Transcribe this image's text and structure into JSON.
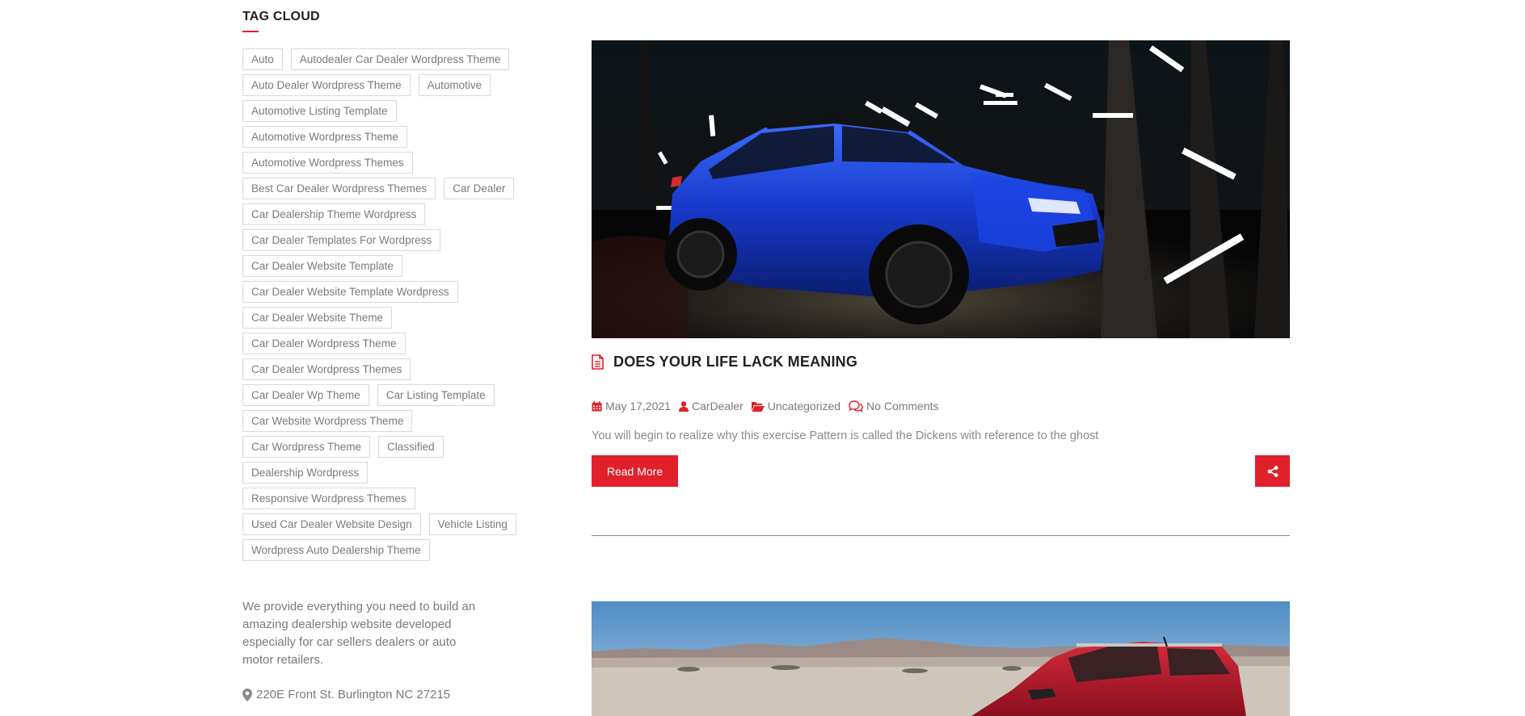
{
  "sidebar": {
    "title": "TAG CLOUD",
    "tags": [
      "Auto",
      "Autodealer Car Dealer Wordpress Theme",
      "Auto Dealer Wordpress Theme",
      "Automotive",
      "Automotive Listing Template",
      "Automotive Wordpress Theme",
      "Automotive Wordpress Themes",
      "Best Car Dealer Wordpress Themes",
      "Car Dealer",
      "Car Dealership Theme Wordpress",
      "Car Dealer Templates For Wordpress",
      "Car Dealer Website Template",
      "Car Dealer Website Template Wordpress",
      "Car Dealer Website Theme",
      "Car Dealer Wordpress Theme",
      "Car Dealer Wordpress Themes",
      "Car Dealer Wp Theme",
      "Car Listing Template",
      "Car Website Wordpress Theme",
      "Car Wordpress Theme",
      "Classified",
      "Dealership Wordpress",
      "Responsive Wordpress Themes",
      "Used Car Dealer Website Design",
      "Vehicle Listing",
      "Wordpress Auto Dealership Theme"
    ],
    "about_text": "We provide everything you need to build an amazing dealership website developed especially for car sellers dealers or auto motor retailers.",
    "address": "220E Front St. Burlington NC 27215"
  },
  "post": {
    "title": "DOES YOUR LIFE LACK MEANING",
    "date": "May 17,2021",
    "author": "CarDealer",
    "category": "Uncategorized",
    "comments": "No Comments",
    "excerpt": "You will begin to realize why this exercise Pattern is called the Dickens with reference to the ghost",
    "read_more_label": "Read More",
    "icons": {
      "title": "document-icon",
      "date": "calendar-icon",
      "author": "user-icon",
      "category": "folder-icon",
      "comments": "comments-icon",
      "share": "share-icon"
    }
  },
  "colors": {
    "accent": "#e0202a",
    "text_muted": "#7a7a7a",
    "heading": "#222222"
  }
}
